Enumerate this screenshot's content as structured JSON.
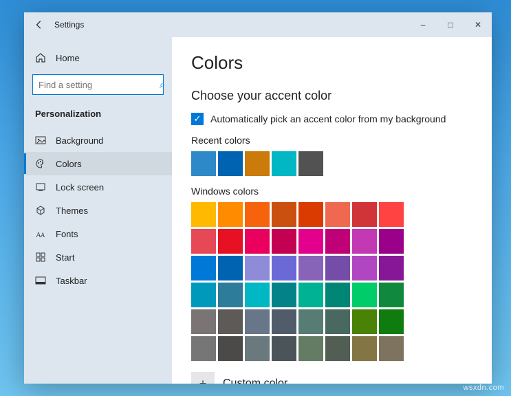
{
  "titlebar": {
    "title": "Settings"
  },
  "sidebar": {
    "home": "Home",
    "search_placeholder": "Find a setting",
    "category": "Personalization",
    "items": [
      {
        "label": "Background"
      },
      {
        "label": "Colors"
      },
      {
        "label": "Lock screen"
      },
      {
        "label": "Themes"
      },
      {
        "label": "Fonts"
      },
      {
        "label": "Start"
      },
      {
        "label": "Taskbar"
      }
    ]
  },
  "page": {
    "title": "Colors",
    "section": "Choose your accent color",
    "auto_checkbox": "Automatically pick an accent color from my background",
    "recent_label": "Recent colors",
    "recent_colors": [
      "#2d89c7",
      "#0063b1",
      "#ca7b0a",
      "#00b7c3",
      "#525252"
    ],
    "windows_label": "Windows colors",
    "windows_colors": [
      "#ffb900",
      "#ff8c00",
      "#f7630c",
      "#ca5010",
      "#da3b01",
      "#ef6950",
      "#d13438",
      "#ff4343",
      "#e74856",
      "#e81123",
      "#ea005e",
      "#c30052",
      "#e3008c",
      "#bf0077",
      "#c239b3",
      "#9a0089",
      "#0078d7",
      "#0063b1",
      "#8e8cd8",
      "#6b69d6",
      "#8764b8",
      "#744da9",
      "#b146c2",
      "#881798",
      "#0099bc",
      "#2d7d9a",
      "#00b7c3",
      "#038387",
      "#00b294",
      "#018574",
      "#00cc6a",
      "#10893e",
      "#7a7574",
      "#5d5a58",
      "#68768a",
      "#515c6b",
      "#567c73",
      "#486860",
      "#498205",
      "#107c10",
      "#767676",
      "#4c4a48",
      "#69797e",
      "#4a5459",
      "#647c64",
      "#525e54",
      "#847545",
      "#7e735f"
    ],
    "custom_label": "Custom color"
  },
  "watermark": "wsxdn.com"
}
